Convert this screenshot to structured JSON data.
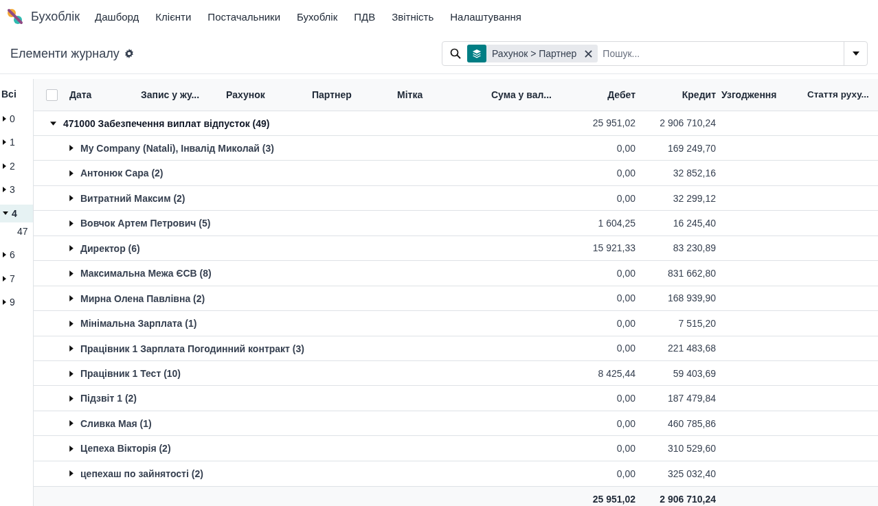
{
  "app": {
    "name": "Бухоблік"
  },
  "menu": [
    "Дашборд",
    "Клієнти",
    "Постачальники",
    "Бухоблік",
    "ПДВ",
    "Звітність",
    "Налаштування"
  ],
  "page": {
    "title": "Елементи журналу"
  },
  "search": {
    "facet": "Рахунок > Партнер",
    "placeholder": "Пошук..."
  },
  "sidebar": {
    "all_label": "Всі",
    "items": [
      {
        "label": "0",
        "expanded": false,
        "selected": false
      },
      {
        "label": "1",
        "expanded": false,
        "selected": false
      },
      {
        "label": "2",
        "expanded": false,
        "selected": false
      },
      {
        "label": "3",
        "expanded": false,
        "selected": false
      },
      {
        "label": "4",
        "expanded": true,
        "selected": true,
        "children": [
          {
            "label": "47"
          }
        ]
      },
      {
        "label": "6",
        "expanded": false,
        "selected": false
      },
      {
        "label": "7",
        "expanded": false,
        "selected": false
      },
      {
        "label": "9",
        "expanded": false,
        "selected": false
      }
    ]
  },
  "table": {
    "checked": false,
    "columns": [
      {
        "label": "Дата",
        "kind": "text"
      },
      {
        "label": "Запис у жу...",
        "kind": "text"
      },
      {
        "label": "Рахунок",
        "kind": "text"
      },
      {
        "label": "Партнер",
        "kind": "text"
      },
      {
        "label": "Мітка",
        "kind": "text"
      },
      {
        "label": "Сума у вал...",
        "kind": "text"
      },
      {
        "label": "Дебет",
        "kind": "amount"
      },
      {
        "label": "Кредит",
        "kind": "amount"
      },
      {
        "label": "Узгодження",
        "kind": "text"
      },
      {
        "label": "Стаття руху...",
        "kind": "text"
      }
    ],
    "groups": [
      {
        "label": "471000 Забезпечення виплат відпусток (49)",
        "debit": "25 951,02",
        "credit": "2 906 710,24",
        "expanded": true,
        "children": [
          {
            "label": "My Company (Natali), Інвалід Миколай (3)",
            "debit": "0,00",
            "credit": "169 249,70",
            "expanded": false
          },
          {
            "label": "Антонюк Сара (2)",
            "debit": "0,00",
            "credit": "32 852,16",
            "expanded": false
          },
          {
            "label": "Витратний Максим (2)",
            "debit": "0,00",
            "credit": "32 299,12",
            "expanded": false
          },
          {
            "label": "Вовчок Артем Петрович (5)",
            "debit": "1 604,25",
            "credit": "16 245,40",
            "expanded": false
          },
          {
            "label": "Директор (6)",
            "debit": "15 921,33",
            "credit": "83 230,89",
            "expanded": false
          },
          {
            "label": "Максимальна Межа ЄСВ (8)",
            "debit": "0,00",
            "credit": "831 662,80",
            "expanded": false
          },
          {
            "label": "Мирна Олена Павлівна (2)",
            "debit": "0,00",
            "credit": "168 939,90",
            "expanded": false
          },
          {
            "label": "Мінімальна Зарплата (1)",
            "debit": "0,00",
            "credit": "7 515,20",
            "expanded": false
          },
          {
            "label": "Працівник 1 Зарплата Погодинний контракт (3)",
            "debit": "0,00",
            "credit": "221 483,68",
            "expanded": false
          },
          {
            "label": "Працівник 1 Тест (10)",
            "debit": "8 425,44",
            "credit": "59 403,69",
            "expanded": false
          },
          {
            "label": "Підзвіт 1 (2)",
            "debit": "0,00",
            "credit": "187 479,84",
            "expanded": false
          },
          {
            "label": "Сливка Мая (1)",
            "debit": "0,00",
            "credit": "460 785,86",
            "expanded": false
          },
          {
            "label": "Цепеха Вікторія (2)",
            "debit": "0,00",
            "credit": "310 529,60",
            "expanded": false
          },
          {
            "label": "цепехаш по зайнятості (2)",
            "debit": "0,00",
            "credit": "325 032,40",
            "expanded": false
          }
        ]
      }
    ],
    "totals": {
      "debit": "25 951,02",
      "credit": "2 906 710,24"
    }
  }
}
